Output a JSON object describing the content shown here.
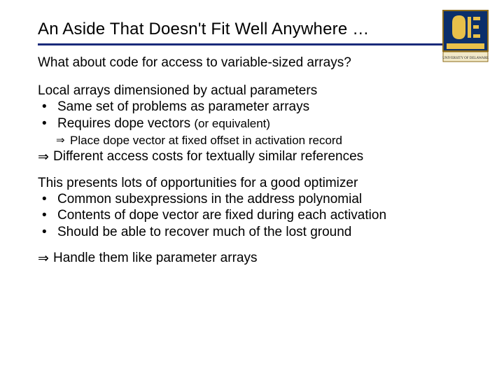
{
  "title": "An Aside That Doesn't Fit Well Anywhere …",
  "question": "What about code for access to variable-sized arrays?",
  "block1": {
    "lead": "Local arrays dimensioned by actual parameters",
    "bullets": [
      "Same set of problems as parameter arrays",
      "Requires dope vectors "
    ],
    "bullet2_suffix": "(or equivalent)",
    "sub": "Place dope vector at fixed offset in activation record",
    "result": "Different access costs for textually similar references"
  },
  "block2": {
    "lead": "This presents lots of opportunities for a good optimizer",
    "bullets": [
      "Common subexpressions in the address polynomial",
      "Contents of dope vector are fixed during each activation",
      "Should be able to recover much of the lost ground"
    ],
    "result": "Handle them like parameter arrays"
  },
  "logo_alt": "University of Delaware"
}
